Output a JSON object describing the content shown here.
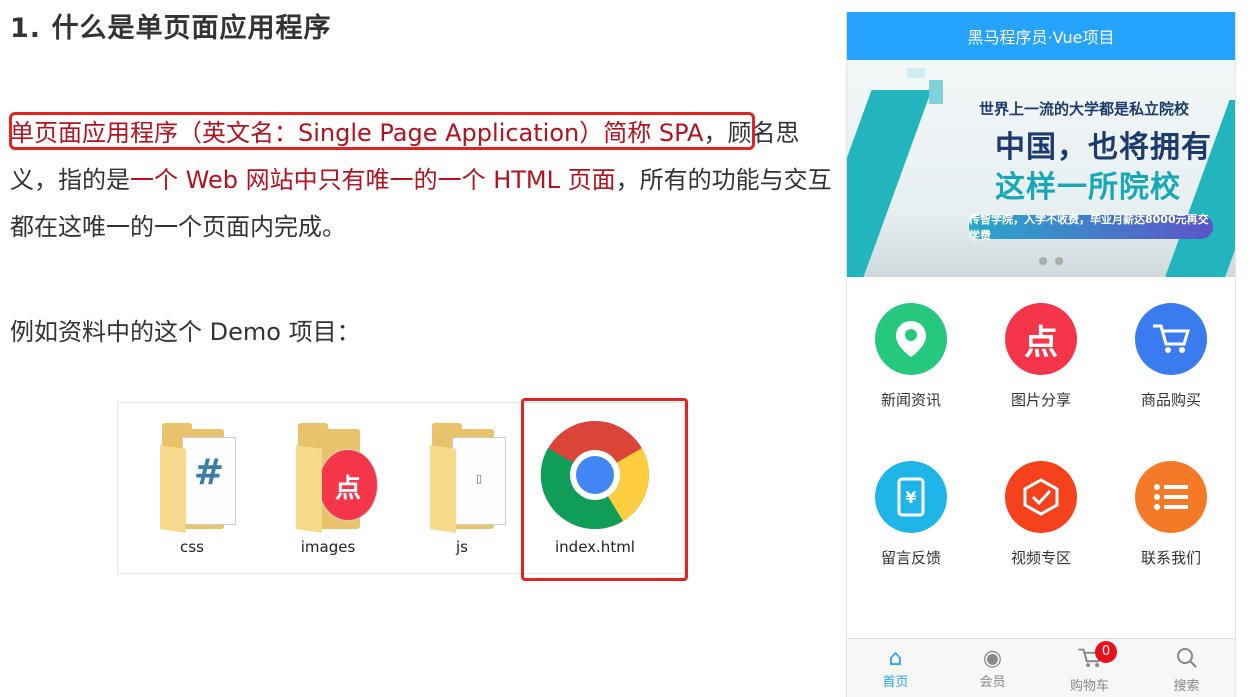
{
  "doc": {
    "heading": "1. 什么是单页面应用程序",
    "para": {
      "part1": "单页面应用程序（英文名：Single Page Application）简称 SPA",
      "part2": "，顾名思义，指的是",
      "part3": "一个 Web 网站中只有唯一的一个 HTML 页面",
      "part4": "，所有的功能与交互都在这唯一的一个页面内完成。"
    },
    "example": "例如资料中的这个 Demo 项目：",
    "files": [
      {
        "name": "css"
      },
      {
        "name": "images"
      },
      {
        "name": "js"
      },
      {
        "name": "index.html"
      }
    ]
  },
  "phone": {
    "title": "黑马程序员·Vue项目",
    "banner": {
      "subtitle": "世界上一流的大学都是私立院校",
      "title1": "中国，也将拥有",
      "title2": "这样一所院校",
      "pill": "传智学院，入学不收费，毕业月薪达8000元再交学费"
    },
    "grid": [
      {
        "label": "新闻资讯",
        "icon": "location-icon",
        "color": "#26c87e",
        "glyph": "⚲"
      },
      {
        "label": "图片分享",
        "icon": "dian-icon",
        "color": "#f5364a",
        "glyph": "点"
      },
      {
        "label": "商品购买",
        "icon": "cart-icon",
        "color": "#3b7bf0",
        "glyph": "🛒"
      },
      {
        "label": "留言反馈",
        "icon": "yen-phone-icon",
        "color": "#20b5e8",
        "glyph": "¥"
      },
      {
        "label": "视频专区",
        "icon": "check-shield-icon",
        "color": "#f5421d",
        "glyph": "✓"
      },
      {
        "label": "联系我们",
        "icon": "list-icon",
        "color": "#f57a27",
        "glyph": "☰"
      }
    ],
    "tabs": [
      {
        "label": "首页",
        "icon": "home-icon",
        "glyph": "⌂",
        "active": true
      },
      {
        "label": "会员",
        "icon": "user-icon",
        "glyph": "◉",
        "active": false
      },
      {
        "label": "购物车",
        "icon": "cart-icon",
        "glyph": "🛒",
        "active": false,
        "badge": "0"
      },
      {
        "label": "搜索",
        "icon": "search-icon",
        "glyph": "⌕",
        "active": false
      }
    ]
  }
}
